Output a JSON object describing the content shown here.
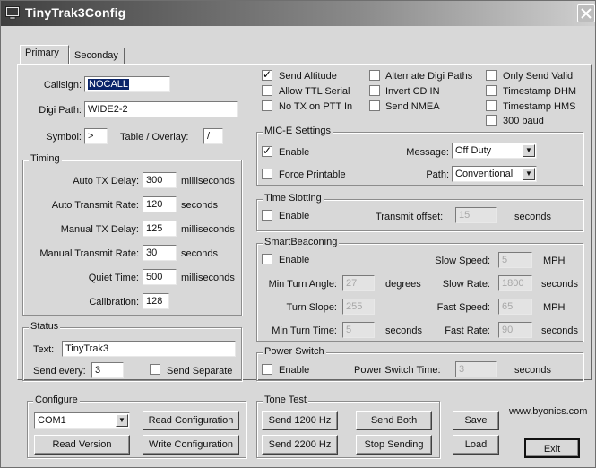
{
  "window": {
    "title": "TinyTrak3Config"
  },
  "tabs": [
    {
      "label": "Primary"
    },
    {
      "label": "Seconday"
    }
  ],
  "primary": {
    "callsign": {
      "label": "Callsign:",
      "value": "NOCALL"
    },
    "digi_path": {
      "label": "Digi Path:",
      "value": "WIDE2-2"
    },
    "symbol": {
      "label": "Symbol:",
      "value": ">"
    },
    "overlay": {
      "label": "Table / Overlay:",
      "value": "/"
    }
  },
  "timing": {
    "title": "Timing",
    "rows": [
      {
        "label": "Auto TX Delay:",
        "value": "300",
        "unit": "milliseconds"
      },
      {
        "label": "Auto Transmit Rate:",
        "value": "120",
        "unit": "seconds"
      },
      {
        "label": "Manual TX Delay:",
        "value": "125",
        "unit": "milliseconds"
      },
      {
        "label": "Manual Transmit Rate:",
        "value": "30",
        "unit": "seconds"
      },
      {
        "label": "Quiet Time:",
        "value": "500",
        "unit": "milliseconds"
      },
      {
        "label": "Calibration:",
        "value": "128",
        "unit": ""
      }
    ]
  },
  "status": {
    "title": "Status",
    "text_label": "Text:",
    "text_value": "TinyTrak3",
    "send_every_label": "Send every:",
    "send_every_value": "3",
    "send_separate": {
      "label": "Send Separate",
      "checked": false
    }
  },
  "options": {
    "col1": [
      {
        "label": "Send Altitude",
        "checked": true
      },
      {
        "label": "Allow TTL Serial",
        "checked": false
      },
      {
        "label": "No TX on PTT In",
        "checked": false
      }
    ],
    "col2": [
      {
        "label": "Alternate Digi Paths",
        "checked": false
      },
      {
        "label": "Invert CD IN",
        "checked": false
      },
      {
        "label": "Send NMEA",
        "checked": false
      }
    ],
    "col3": [
      {
        "label": "Only Send Valid",
        "checked": false
      },
      {
        "label": "Timestamp DHM",
        "checked": false
      },
      {
        "label": "Timestamp HMS",
        "checked": false
      },
      {
        "label": "300 baud",
        "checked": false
      }
    ]
  },
  "mice": {
    "title": "MIC-E Settings",
    "enable": {
      "label": "Enable",
      "checked": true
    },
    "force_printable": {
      "label": "Force Printable",
      "checked": false
    },
    "message_label": "Message:",
    "message_value": "Off Duty",
    "path_label": "Path:",
    "path_value": "Conventional"
  },
  "time_slotting": {
    "title": "Time Slotting",
    "enable": {
      "label": "Enable",
      "checked": false
    },
    "offset_label": "Transmit offset:",
    "offset_value": "15",
    "offset_unit": "seconds"
  },
  "smartbeaconing": {
    "title": "SmartBeaconing",
    "enable": {
      "label": "Enable",
      "checked": false
    },
    "min_turn_angle": {
      "label": "Min Turn Angle:",
      "value": "27",
      "unit": "degrees"
    },
    "turn_slope": {
      "label": "Turn Slope:",
      "value": "255"
    },
    "min_turn_time": {
      "label": "Min Turn Time:",
      "value": "5",
      "unit": "seconds"
    },
    "slow_speed": {
      "label": "Slow Speed:",
      "value": "5",
      "unit": "MPH"
    },
    "slow_rate": {
      "label": "Slow Rate:",
      "value": "1800",
      "unit": "seconds"
    },
    "fast_speed": {
      "label": "Fast Speed:",
      "value": "65",
      "unit": "MPH"
    },
    "fast_rate": {
      "label": "Fast Rate:",
      "value": "90",
      "unit": "seconds"
    }
  },
  "power_switch": {
    "title": "Power Switch",
    "enable": {
      "label": "Enable",
      "checked": false
    },
    "time_label": "Power Switch Time:",
    "time_value": "3",
    "time_unit": "seconds"
  },
  "configure": {
    "title": "Configure",
    "port_value": "COM1",
    "read_config": "Read Configuration",
    "read_version": "Read Version",
    "write_config": "Write Configuration"
  },
  "tone_test": {
    "title": "Tone Test",
    "send_1200": "Send 1200 Hz",
    "send_2200": "Send 2200 Hz",
    "send_both": "Send Both",
    "stop_sending": "Stop Sending"
  },
  "footer": {
    "save": "Save",
    "load": "Load",
    "exit": "Exit",
    "website": "www.byonics.com"
  }
}
